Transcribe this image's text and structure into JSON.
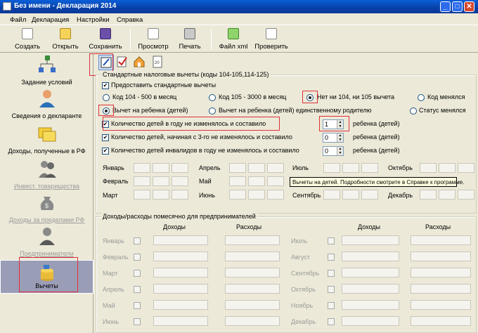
{
  "window": {
    "title": "Без имени - Декларация 2014"
  },
  "menu": [
    "Файл",
    "Декларация",
    "Настройки",
    "Справка"
  ],
  "toolbar": {
    "create": "Создать",
    "open": "Открыть",
    "save": "Сохранить",
    "preview": "Просмотр",
    "print": "Печать",
    "xml": "Файл xml",
    "check": "Проверить"
  },
  "sidebar": {
    "items": [
      {
        "label": "Задание условий"
      },
      {
        "label": "Сведения о декларанте"
      },
      {
        "label": "Доходы, полученные в РФ"
      },
      {
        "label": "Инвест. товарищества"
      },
      {
        "label": "Доходы за пределами РФ"
      },
      {
        "label": "Предприниматели"
      },
      {
        "label": "Вычеты"
      }
    ]
  },
  "std": {
    "title": "Стандартные налоговые вычеты (коды 104-105,114-125)",
    "provide": "Предоставить стандартные вычеты",
    "code104": "Код 104 - 500 в месяц",
    "code105": "Код 105 - 3000 в месяц",
    "no104": "Нет ни 104, ни 105 вычета",
    "changed": "Код менялся",
    "child": "Вычет на ребенка (детей)",
    "child_single": "Вычет на ребенка (детей) единственному родителю",
    "status_changed": "Статус менялся",
    "cnt_label": "Количество детей в году не изменялось и составило",
    "cnt_value": "1",
    "cnt_unit": "ребенка (детей)",
    "cnt3_label": "Количество детей, начиная с 3-го не изменялось и составило",
    "cnt3_value": "0",
    "cnt3_unit": "ребенка (детей)",
    "dis_label": "Количество детей инвалидов в году не изменялось и составило",
    "dis_value": "0",
    "dis_unit": "ребенка (детей)"
  },
  "months": {
    "jan": "Январь",
    "feb": "Февраль",
    "mar": "Март",
    "apr": "Апрель",
    "may": "Май",
    "jun": "Июнь",
    "jul": "Июль",
    "aug": "Август",
    "sep": "Сентябрь",
    "oct": "Октябрь",
    "nov": "Ноябрь",
    "dec": "Декабрь"
  },
  "tooltip": "Вычеты на детей. Подробности смотрите в Справке к программе.",
  "entre": {
    "title": "Доходы/расходы помесячно для предпринимателей",
    "income": "Доходы",
    "expense": "Расходы",
    "left": [
      "Январь",
      "Февраль",
      "Март",
      "Апрель",
      "Май",
      "Июнь"
    ],
    "right": [
      "Июль",
      "Август",
      "Сентябрь",
      "Октябрь",
      "Ноябрь",
      "Декабрь"
    ]
  }
}
